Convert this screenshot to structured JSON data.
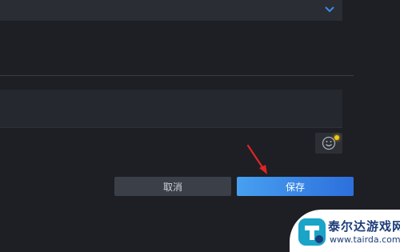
{
  "form": {
    "cancel_label": "取消",
    "save_label": "保存"
  },
  "icons": {
    "dropdown": "chevron-down-icon",
    "emoji": "smiley-icon",
    "annotation": "arrow-icon"
  },
  "colors": {
    "accent": "#2d6fdc",
    "chevron": "#3d8de6",
    "arrow": "#e02424",
    "notify": "#f5c518"
  },
  "watermark": {
    "name": "泰尔达游戏网",
    "url": "www.tairda.com"
  }
}
